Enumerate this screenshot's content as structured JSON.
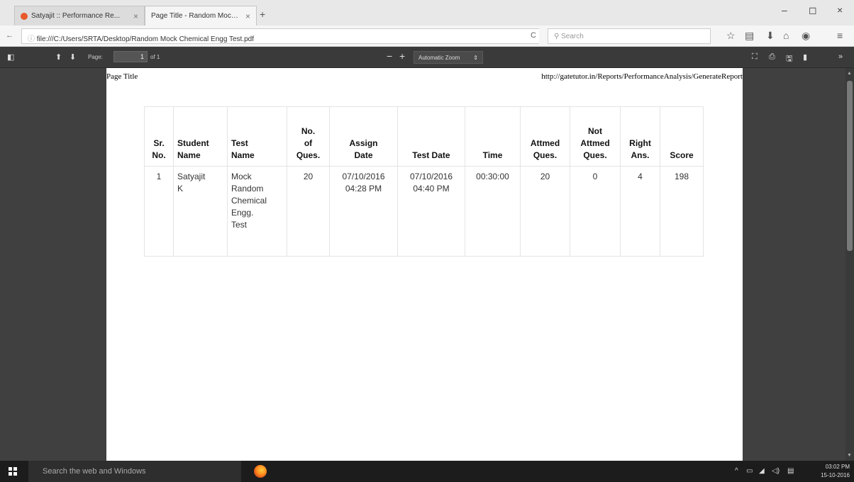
{
  "tabs": [
    {
      "title": "Satyajit :: Performance Re...",
      "close": "×"
    },
    {
      "title": "Page Title - Random Mock Ch...",
      "close": "×"
    }
  ],
  "new_tab": "+",
  "window_controls": {
    "minimize": "–",
    "maximize": "◻",
    "close": "×"
  },
  "nav": {
    "url": "file:///C:/Users/SRTA/Desktop/Random Mock Chemical Engg Test.pdf",
    "search_placeholder": "Search"
  },
  "pdf_toolbar": {
    "page_label": "Page:",
    "page_number": "1",
    "page_of": "of 1",
    "zoom_out": "−",
    "zoom_in": "+",
    "zoom_label": "Automatic Zoom"
  },
  "page": {
    "header_left": "Page Title",
    "header_right": "http://gatetutor.in/Reports/PerformanceAnalysis/GenerateReport"
  },
  "table": {
    "headers": [
      "Sr.\nNo.",
      "Student\nName",
      "Test\nName",
      "No.\nof\nQues.",
      "Assign\nDate",
      "Test Date",
      "Time",
      "Attmed\nQues.",
      "Not\nAttmed\nQues.",
      "Right\nAns.",
      "Score"
    ],
    "rows": [
      {
        "sr": "1",
        "student": "Satyajit\nK",
        "test": "Mock\nRandom\nChemical\nEngg.\nTest",
        "num_ques": "20",
        "assign_date": "07/10/2016\n04:28 PM",
        "test_date": "07/10/2016\n04:40 PM",
        "time": "00:30:00",
        "attempted": "20",
        "not_attempted": "0",
        "right": "4",
        "score": "198"
      }
    ]
  },
  "taskbar": {
    "search_placeholder": "Search the web and Windows",
    "time": "03:02 PM",
    "date": "15-10-2016"
  },
  "colors": {
    "tab_favicon": "#e8592b",
    "pdf_toolbar": "#3a3a3a",
    "viewer_bg": "#404040"
  }
}
